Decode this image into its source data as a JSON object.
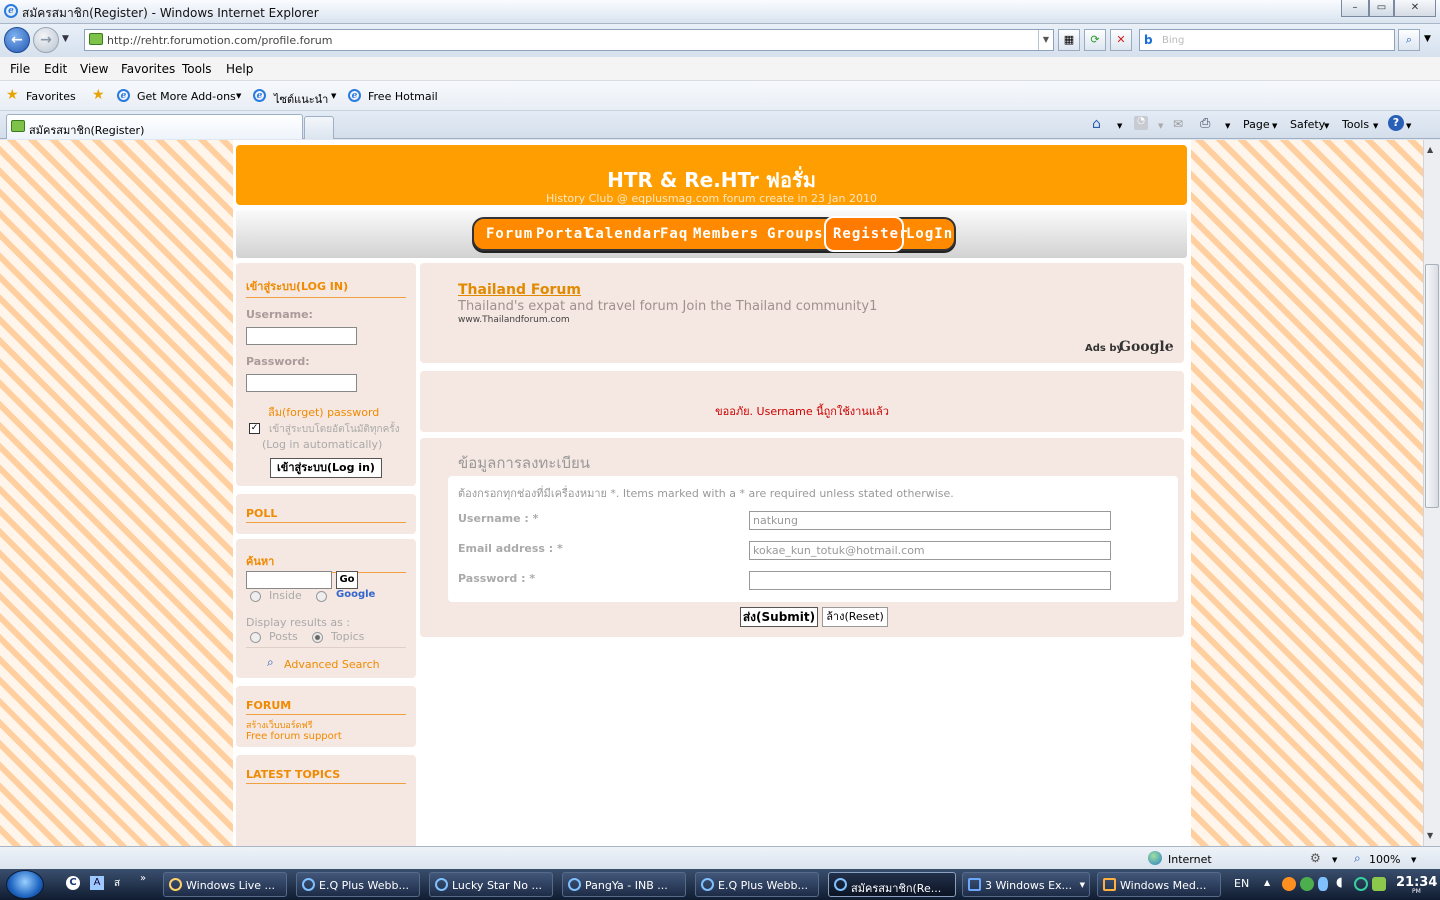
{
  "window": {
    "title": "สมัครสมาชิก(Register) - Windows Internet Explorer"
  },
  "address": {
    "url": "http://rehtr.forumotion.com/profile.forum"
  },
  "search": {
    "placeholder": "Bing"
  },
  "menu": [
    "File",
    "Edit",
    "View",
    "Favorites",
    "Tools",
    "Help"
  ],
  "favorites": {
    "label": "Favorites",
    "items": [
      "Get More Add-ons",
      "ไซต์แนะนำ",
      "Free Hotmail"
    ]
  },
  "tab": {
    "title": "สมัครสมาชิก(Register)"
  },
  "commandbar": {
    "page": "Page",
    "safety": "Safety",
    "tools": "Tools"
  },
  "site": {
    "title": "HTR & Re.HTr ฟอรั่ม",
    "subtitle": "History Club @ eqplusmag.com forum create in 23 Jan 2010",
    "nav": [
      "Forum",
      "Portal",
      "Calendar",
      "Faq",
      "Members",
      "Groups",
      "Register",
      "LogIn"
    ]
  },
  "login": {
    "title": "เข้าสู่ระบบ(LOG IN)",
    "username_label": "Username:",
    "password_label": "Password:",
    "forgot": "ลืม(forget) password",
    "auto_login_th": "เข้าสู่ระบบโดยอัตโนมัติทุกครั้ง",
    "auto_login_en": "(Log in automatically)",
    "button": "เข้าสู่ระบบ(Log in)"
  },
  "poll": {
    "title": "POLL"
  },
  "searchbox": {
    "title": "ค้นหา",
    "go": "Go",
    "inside": "Inside",
    "google": "Google",
    "display_as": "Display results as :",
    "posts": "Posts",
    "topics": "Topics",
    "advanced": "Advanced Search"
  },
  "forumbox": {
    "title": "FORUM",
    "line1": "สร้างเว็บบอร์ดฟรี",
    "line2": "Free forum support"
  },
  "latest": {
    "title": "LATEST TOPICS"
  },
  "ad": {
    "title": "Thailand Forum",
    "desc": "Thailand's expat and travel forum Join the Thailand community1",
    "url": "www.Thailandforum.com",
    "adsby": "Ads by",
    "google": "Google"
  },
  "error": {
    "message": "ขออภัย. Username นี้ถูกใช้งานแล้ว"
  },
  "form": {
    "title": "ข้อมูลการลงทะเบียน",
    "note": "ต้องกรอกทุกช่องที่มีเครื่องหมาย *. Items marked with a * are required unless stated otherwise.",
    "username_label": "Username : *",
    "username_value": "natkung",
    "email_label": "Email address : *",
    "email_value": "kokae_kun_totuk@hotmail.com",
    "password_label": "Password : *",
    "submit": "ส่ง(Submit)",
    "reset": "ล้าง(Reset)"
  },
  "status": {
    "zone": "Internet",
    "zoom": "100%"
  },
  "taskbar": {
    "tasks": [
      "Windows Live ...",
      "E.Q Plus Webb...",
      "Lucky Star No ...",
      "PangYa - INB ...",
      "E.Q Plus Webb...",
      "สมัครสมาชิก(Re...",
      "3 Windows Ex...",
      "Windows Med..."
    ],
    "lang": "EN",
    "time": "21:34",
    "ampm": "PM"
  }
}
